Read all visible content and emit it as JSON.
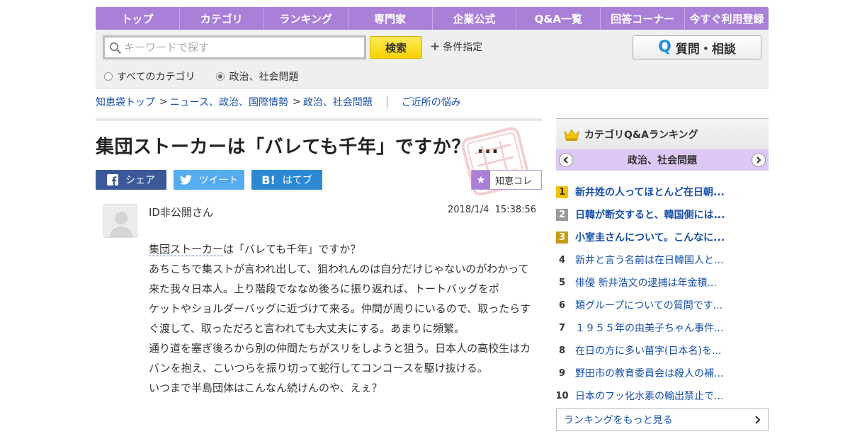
{
  "nav": {
    "items": [
      "トップ",
      "カテゴリ",
      "ランキング",
      "専門家",
      "企業公式",
      "Q&A一覧",
      "回答コーナー",
      "今すぐ利用登録"
    ]
  },
  "search": {
    "placeholder": "キーワードで探す",
    "value": "",
    "button_label": "検索",
    "condition_label": "条件指定",
    "ask_button_label": "質問・相談",
    "ask_icon_letter": "Q",
    "scope_all": "すべてのカテゴリ",
    "scope_current": "政治、社会問題",
    "selected_scope": "scope_current"
  },
  "breadcrumb": {
    "items": [
      "知恵袋トップ",
      "ニュース、政治、国際情勢",
      "政治、社会問題"
    ],
    "separator": ">",
    "related": "ご近所の悩み"
  },
  "question": {
    "title": "集団ストーカーは「バレても千年」ですか？ ...",
    "share": {
      "facebook": "シェア",
      "twitter": "ツイート",
      "hatena": "はてブ",
      "hatena_icon": "B!"
    },
    "chie_collection_label": "知恵コレ",
    "user": "ID非公開さん",
    "date": "2018/1/4",
    "time": "15:38:56",
    "body_keyword": "集団ストーカー",
    "body_first_line_rest": "は「バレても千年」ですか？",
    "body_paragraphs": [
      "あちこちで集ストが言われ出して、狙われんのは自分だけじゃないのがわかって来た我々日本人。上り階段でななめ後ろに振り返れば、トートバッグをポ",
      "ケットやショルダーバッグに近づけて来る。仲間が周りにいるので、取ったらすぐ渡して、取っただろと言われても大丈夫にする。あまりに頻繁。",
      "通り道を塞ぎ後ろから別の仲間たちがスリをしようと狙う。日本人の高校生はカバンを抱え、こいつらを振り切って蛇行してコンコースを駆け抜ける。",
      "いつまで半島団体はこんなん続けんのや、えぇ？"
    ]
  },
  "ranking": {
    "title": "カテゴリQ&Aランキング",
    "category": "政治、社会問題",
    "items": [
      {
        "rank": "1",
        "text": "新井姓の人ってほとんど在日朝..."
      },
      {
        "rank": "2",
        "text": "日韓が断交すると、韓国側には..."
      },
      {
        "rank": "3",
        "text": "小室圭さんについて。こんなに..."
      },
      {
        "rank": "4",
        "text": "新井と言う名前は在日韓国人と..."
      },
      {
        "rank": "5",
        "text": "俳優 新井浩文の逮捕は年金積..."
      },
      {
        "rank": "6",
        "text": "類グループについての質問です..."
      },
      {
        "rank": "7",
        "text": "１９５５年の由美子ちゃん事件..."
      },
      {
        "rank": "8",
        "text": "在日の方に多い苗字(日本名)を..."
      },
      {
        "rank": "9",
        "text": "野田市の教育委員会は殺人の補..."
      },
      {
        "rank": "10",
        "text": "日本のフッ化水素の輸出禁止で..."
      }
    ],
    "more_label": "ランキングをもっと見る"
  },
  "colors": {
    "nav_bg": "#a97fd8",
    "link": "#1750a8",
    "search_button": "#f6d300",
    "facebook": "#3b5998",
    "twitter": "#55acee",
    "hatena": "#2b89d3",
    "rank_gold": "#f4c300",
    "rank_silver": "#9a9a9a",
    "rank_bronze": "#c99c14"
  },
  "icons": {
    "search": "magnifier-icon",
    "facebook": "facebook-icon",
    "twitter": "twitter-bird-icon",
    "star": "star-icon",
    "crown": "crown-icon",
    "chevron_left": "chevron-left-icon",
    "chevron_right": "chevron-right-icon"
  }
}
